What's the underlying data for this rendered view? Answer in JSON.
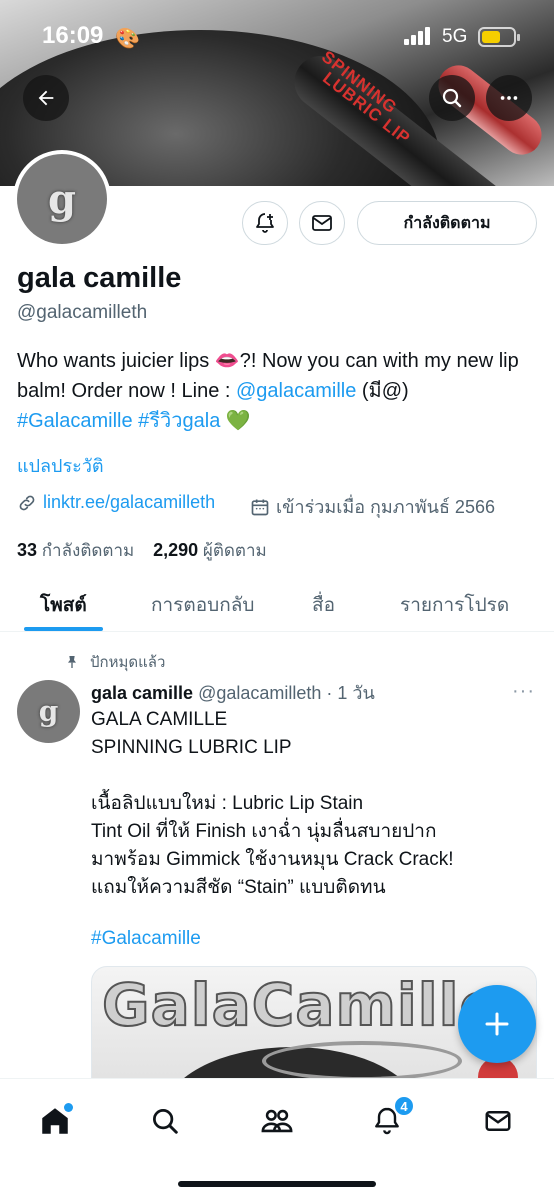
{
  "status_bar": {
    "time": "16:09",
    "network": "5G"
  },
  "banner": {
    "product_text_line1": "SPINNING",
    "product_text_line2": "LUBRIC LIP"
  },
  "profile": {
    "avatar_letter": "g",
    "name": "gala camille",
    "handle": "@galacamilleth",
    "follow_state_label": "กำลังติดตาม",
    "bio_text_1": "Who wants juicier lips 👄?! Now you can with my new lip balm! Order now ! Line : ",
    "bio_mention": "@galacamille",
    "bio_text_2": " (มี@)",
    "bio_hashtag_1": "#Galacamille",
    "bio_hashtag_2": "#รีวิวgala",
    "bio_emoji": "💚",
    "translate_label": "แปลประวัติ",
    "link_text": "linktr.ee/galacamilleth",
    "joined_text": "เข้าร่วมเมื่อ กุมภาพันธ์ 2566",
    "following_count": "33",
    "following_label": "กำลังติดตาม",
    "followers_count": "2,290",
    "followers_label": "ผู้ติดตาม"
  },
  "tabs": [
    {
      "label": "โพสต์",
      "active": true
    },
    {
      "label": "การตอบกลับ",
      "active": false
    },
    {
      "label": "สื่อ",
      "active": false
    },
    {
      "label": "รายการโปรด",
      "active": false
    }
  ],
  "pinned_post": {
    "pinned_label": "ปักหมุดแล้ว",
    "author_name": "gala camille",
    "author_handle": "@galacamilleth",
    "age": "· 1 วัน",
    "text": "GALA CAMILLE\nSPINNING LUBRIC LIP\n\nเนื้อลิปแบบใหม่ : Lubric Lip Stain\nTint Oil ที่ให้ Finish เงาฉ่ำ นุ่มลื่นสบายปาก\nมาพร้อม Gimmick ใช้งานหมุน Crack Crack!\nแถมให้ความสีชัด “Stain” แบบติดทน",
    "hashtag": "#Galacamille",
    "media_brand_text": "GalaCamille"
  },
  "bottom_nav": {
    "notifications_badge": "4"
  },
  "colors": {
    "accent": "#1d9bf0",
    "text_primary": "#0f1419",
    "text_secondary": "#536471"
  },
  "icons": [
    "back-arrow-icon",
    "search-icon",
    "more-icon",
    "add-notification-icon",
    "message-icon",
    "link-icon",
    "calendar-icon",
    "pin-icon",
    "compose-plus-icon",
    "home-icon",
    "explore-icon",
    "communities-icon",
    "notifications-icon",
    "messages-icon"
  ]
}
